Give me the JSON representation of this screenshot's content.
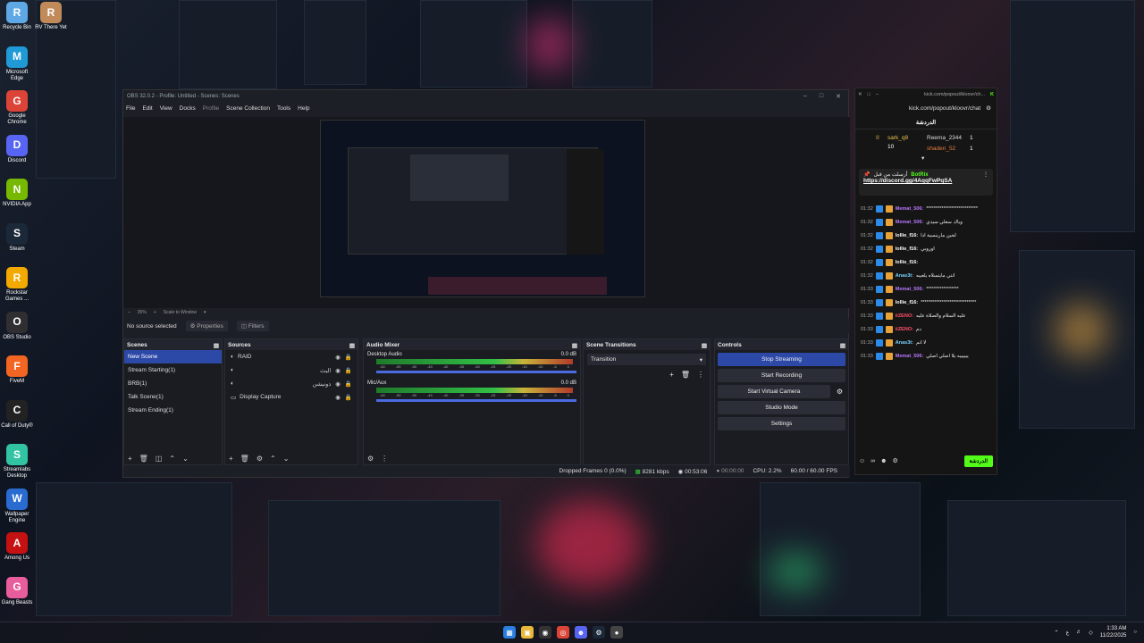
{
  "desktop": {
    "icons": [
      {
        "label": "Recycle Bin",
        "icon": "recycle-bin-icon",
        "color": "#5fa8e6"
      },
      {
        "label": "RV There Yet",
        "icon": "game-icon",
        "color": "#c08a5a"
      },
      {
        "label": "Microsoft Edge",
        "icon": "edge-icon",
        "color": "#1f9ad6"
      },
      {
        "label": "Google Chrome",
        "icon": "chrome-icon",
        "color": "#db4437"
      },
      {
        "label": "Discord",
        "icon": "discord-icon",
        "color": "#5865f2"
      },
      {
        "label": "NVIDIA App",
        "icon": "nvidia-icon",
        "color": "#76b900"
      },
      {
        "label": "Steam",
        "icon": "steam-icon",
        "color": "#1b2838"
      },
      {
        "label": "Rockstar Games ...",
        "icon": "rockstar-icon",
        "color": "#f2a900"
      },
      {
        "label": "OBS Studio",
        "icon": "obs-icon",
        "color": "#302e31"
      },
      {
        "label": "FiveM",
        "icon": "fivem-icon",
        "color": "#f26522"
      },
      {
        "label": "Call of Duty®",
        "icon": "cod-icon",
        "color": "#222222"
      },
      {
        "label": "Streamlabs Desktop",
        "icon": "streamlabs-icon",
        "color": "#31c3a2"
      },
      {
        "label": "Wallpaper Engine",
        "icon": "wallpaper-engine-icon",
        "color": "#2a6bd1"
      },
      {
        "label": "Among Us",
        "icon": "among-us-icon",
        "color": "#c51111"
      },
      {
        "label": "Gang Beasts",
        "icon": "gang-beasts-icon",
        "color": "#e85d9c"
      }
    ]
  },
  "obs": {
    "title": "OBS 32.0.2 - Profile: Untitled - Scenes: Scenes",
    "menu": [
      "File",
      "Edit",
      "View",
      "Docks",
      "Profile",
      "Scene Collection",
      "Tools",
      "Help"
    ],
    "zoom": {
      "value": "35%",
      "mode": "Scale to Window"
    },
    "selection": {
      "label": "No source selected",
      "properties": "Properties",
      "filters": "Filters"
    },
    "scenes": {
      "title": "Scenes",
      "items": [
        "New Scene",
        "Stream Starting(1)",
        "BRB(1)",
        "Talk Scene(1)",
        "Stream Ending(1)"
      ]
    },
    "sources": {
      "title": "Sources",
      "items": [
        "RAID",
        "البث",
        "دونيشن",
        "Display Capture"
      ]
    },
    "mixer": {
      "title": "Audio Mixer",
      "channels": [
        {
          "name": "Desktop Audio",
          "db": "0.0 dB"
        },
        {
          "name": "Mic/Aux",
          "db": "0.0 dB"
        }
      ],
      "ticks": [
        "-60",
        "-55",
        "-50",
        "-45",
        "-40",
        "-35",
        "-30",
        "-25",
        "-20",
        "-15",
        "-10",
        "-5",
        "0"
      ]
    },
    "transitions": {
      "title": "Scene Transitions",
      "value": "Transition"
    },
    "controls": {
      "title": "Controls",
      "buttons": [
        "Stop Streaming",
        "Start Recording",
        "Start Virtual Camera",
        "Studio Mode",
        "Settings"
      ]
    },
    "status": {
      "dropped": "Dropped Frames 0 (0.0%)",
      "bitrate": "8281 kbps",
      "stream_time": "00:53:06",
      "rec_time": "00:00:00",
      "cpu": "CPU: 2.2%",
      "fps": "60.00 / 60.00 FPS"
    }
  },
  "chat": {
    "url": "kick.com/popout/kloovr/chat",
    "url_short": "kick.com/popout/kloovr/ch...",
    "header": "الدردشة",
    "top_users": [
      {
        "name": "sark_q8",
        "count": "10"
      },
      {
        "name": "Reema_2344",
        "count": "1"
      },
      {
        "name": "shaden_52",
        "count": "1"
      }
    ],
    "pinned": {
      "by": "أرسلت من قبل",
      "user": "BotRix",
      "link": "https://discord.gg/4AqqFwPqSA"
    },
    "messages": [
      {
        "time": "01:32",
        "user": "Memat_506",
        "text": "***************************",
        "color": "#b877ff"
      },
      {
        "time": "01:32",
        "user": "Memat_506",
        "text": "وياك سعلي سيدي",
        "color": "#b877ff"
      },
      {
        "time": "01:32",
        "user": "lollie_f16",
        "text": "لجين مارينسية ادا",
        "color": "#ffffff"
      },
      {
        "time": "01:32",
        "user": "lollie_f16",
        "text": "اوروبي",
        "color": "#ffffff"
      },
      {
        "time": "01:32",
        "user": "lollie_f16",
        "text": "",
        "color": "#ffffff"
      },
      {
        "time": "01:32",
        "user": "Anas3t",
        "text": "انتي مايتسلاه يلعيبه",
        "color": "#7ad3ff"
      },
      {
        "time": "01:33",
        "user": "Memat_506",
        "text": "*****************",
        "color": "#b877ff"
      },
      {
        "time": "01:33",
        "user": "lollie_f16",
        "text": "*****************************",
        "color": "#ffffff"
      },
      {
        "time": "01:33",
        "user": "iiZENO",
        "text": "عليه السلام والصلاة عليه",
        "color": "#ff4f6a"
      },
      {
        "time": "01:33",
        "user": "iiZENO",
        "text": "دم",
        "color": "#ff4f6a"
      },
      {
        "time": "01:33",
        "user": "Anas3t",
        "text": "لا انم",
        "color": "#7ad3ff"
      },
      {
        "time": "01:33",
        "user": "Memat_506",
        "text": "ييييييه يلا اصلي اصلي",
        "color": "#b877ff"
      }
    ],
    "send_label": "الدردشة",
    "accent": "#53fc18"
  },
  "taskbar": {
    "time": "1:33 AM",
    "date": "11/22/2025",
    "lang": "ع"
  }
}
